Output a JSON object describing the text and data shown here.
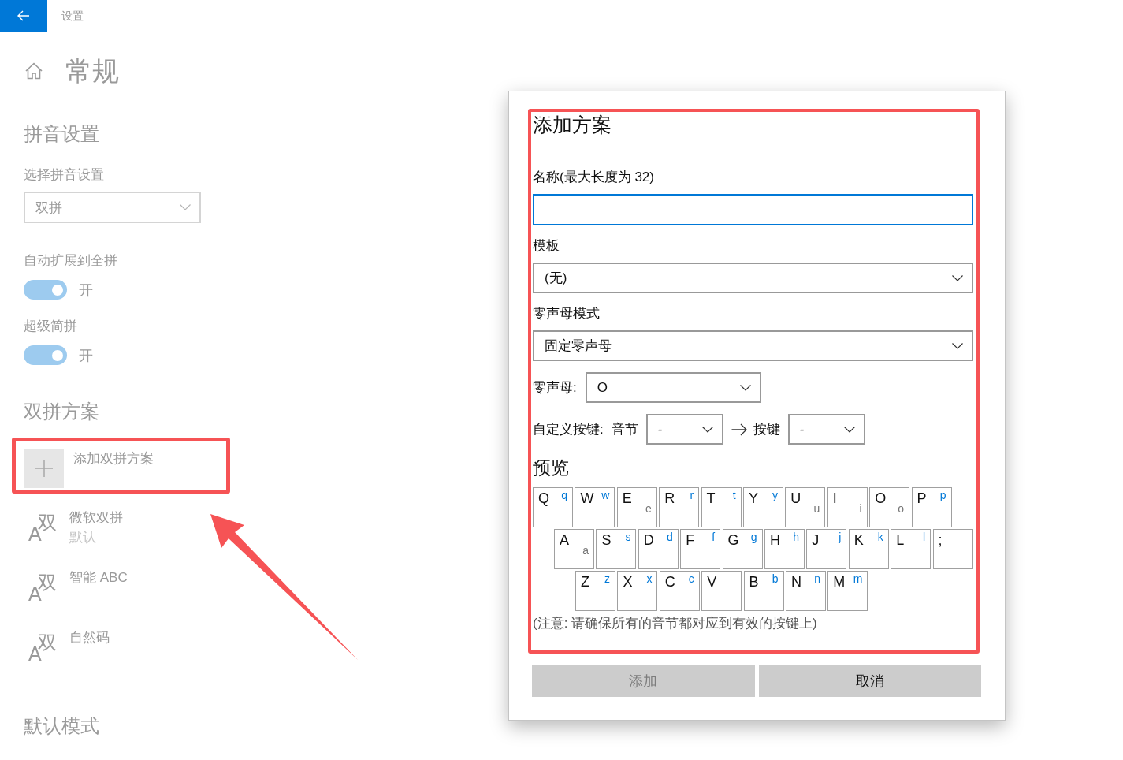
{
  "title_bar": {
    "title": "设置"
  },
  "page": {
    "title": "常规"
  },
  "pinyin_settings": {
    "heading": "拼音设置",
    "select": {
      "label": "选择拼音设置",
      "value": "双拼"
    },
    "toggles": [
      {
        "label": "自动扩展到全拼",
        "on": true,
        "state_text": "开"
      },
      {
        "label": "超级简拼",
        "on": true,
        "state_text": "开"
      }
    ]
  },
  "shuangpin_schemes": {
    "heading": "双拼方案",
    "add_label": "添加双拼方案",
    "schemes": [
      {
        "icon_letter": "A",
        "icon_char": "双",
        "name": "微软双拼",
        "note": "默认"
      },
      {
        "icon_letter": "A",
        "icon_char": "双",
        "name": "智能 ABC"
      },
      {
        "icon_letter": "A",
        "icon_char": "双",
        "name": "自然码"
      }
    ]
  },
  "default_mode": {
    "heading": "默认模式"
  },
  "dialog": {
    "title": "添加方案",
    "name_field": {
      "label": "名称(最大长度为 32)",
      "focused": true
    },
    "template": {
      "label": "模板",
      "value": "(无)"
    },
    "zero_initial_mode": {
      "label": "零声母模式",
      "value": "固定零声母"
    },
    "zero_initial": {
      "label": "零声母:",
      "value": "O"
    },
    "custom_key": {
      "label": "自定义按键:",
      "syllable_label": "音节",
      "syllable_value": "-",
      "key_label": "按键",
      "key_value": "-"
    },
    "preview": {
      "heading": "预览",
      "rows": [
        [
          {
            "label": "Q",
            "mapping": "q",
            "kind": "initial"
          },
          {
            "label": "W",
            "mapping": "w",
            "kind": "initial"
          },
          {
            "label": "E",
            "mapping": "e",
            "kind": "final"
          },
          {
            "label": "R",
            "mapping": "r",
            "kind": "initial"
          },
          {
            "label": "T",
            "mapping": "t",
            "kind": "initial"
          },
          {
            "label": "Y",
            "mapping": "y",
            "kind": "initial"
          },
          {
            "label": "U",
            "mapping": "u",
            "kind": "final"
          },
          {
            "label": "I",
            "mapping": "i",
            "kind": "final"
          },
          {
            "label": "O",
            "mapping": "o",
            "kind": "final"
          },
          {
            "label": "P",
            "mapping": "p",
            "kind": "initial"
          }
        ],
        [
          {
            "label": "A",
            "mapping": "a",
            "kind": "final"
          },
          {
            "label": "S",
            "mapping": "s",
            "kind": "initial"
          },
          {
            "label": "D",
            "mapping": "d",
            "kind": "initial"
          },
          {
            "label": "F",
            "mapping": "f",
            "kind": "initial"
          },
          {
            "label": "G",
            "mapping": "g",
            "kind": "initial"
          },
          {
            "label": "H",
            "mapping": "h",
            "kind": "initial"
          },
          {
            "label": "J",
            "mapping": "j",
            "kind": "initial"
          },
          {
            "label": "K",
            "mapping": "k",
            "kind": "initial"
          },
          {
            "label": "L",
            "mapping": "l",
            "kind": "initial"
          },
          {
            "label": ";",
            "kind": "plain"
          }
        ],
        [
          {
            "label": "Z",
            "mapping": "z",
            "kind": "initial"
          },
          {
            "label": "X",
            "mapping": "x",
            "kind": "initial"
          },
          {
            "label": "C",
            "mapping": "c",
            "kind": "initial"
          },
          {
            "label": "V",
            "kind": "plain"
          },
          {
            "label": "B",
            "mapping": "b",
            "kind": "initial"
          },
          {
            "label": "N",
            "mapping": "n",
            "kind": "initial"
          },
          {
            "label": "M",
            "mapping": "m",
            "kind": "initial"
          }
        ]
      ]
    },
    "note": "(注意: 请确保所有的音节都对应到有效的按键上)",
    "buttons": [
      {
        "label": "添加",
        "disabled": true
      },
      {
        "label": "取消",
        "disabled": false
      }
    ]
  }
}
